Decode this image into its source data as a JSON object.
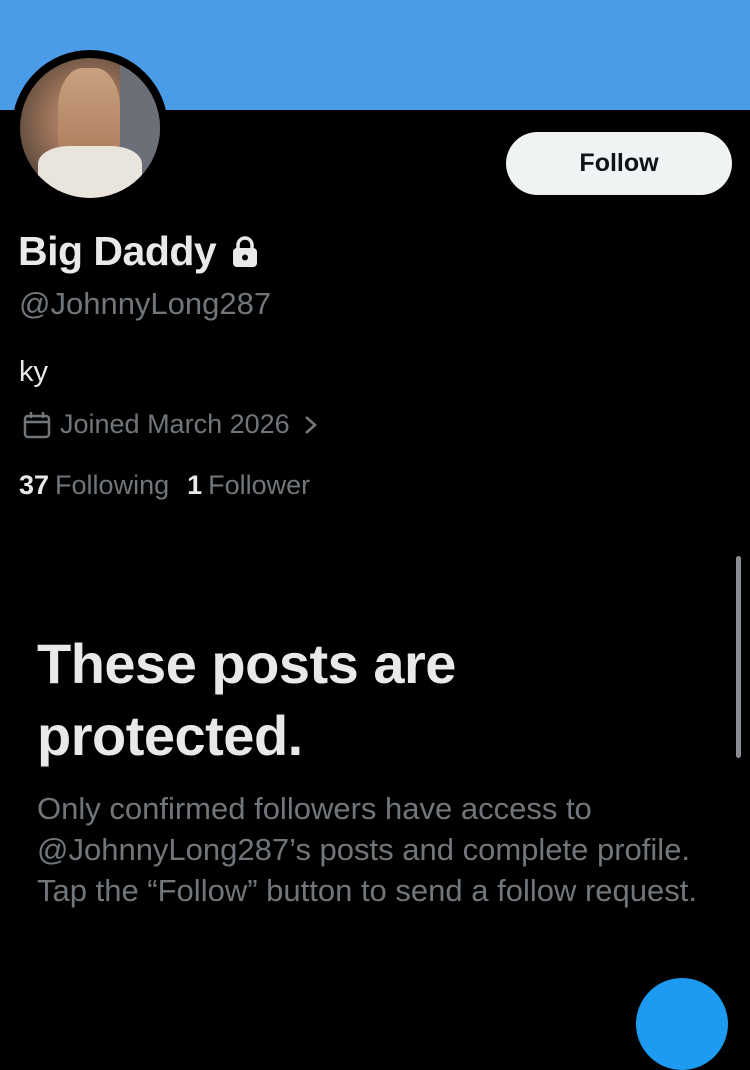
{
  "profile": {
    "display_name": "Big Daddy",
    "handle": "@JohnnyLong287",
    "bio": "ky",
    "joined": "Joined March 2026",
    "following_count": "37",
    "following_label": "Following",
    "followers_count": "1",
    "followers_label": "Follower"
  },
  "actions": {
    "follow_label": "Follow"
  },
  "protected": {
    "title": "These posts are protected.",
    "body": "Only confirmed followers have access to @JohnnyLong287’s posts and complete profile. Tap the “Follow” button to send a follow request."
  },
  "icons": {
    "lock": "lock-icon",
    "calendar": "calendar-icon",
    "chevron": "chevron-right-icon"
  },
  "colors": {
    "banner": "#4a9be8",
    "background": "#000000",
    "primary_text": "#e7e9ea",
    "secondary_text": "#71767b",
    "follow_button_bg": "#eff3f4",
    "accent": "#1d9bf0"
  }
}
